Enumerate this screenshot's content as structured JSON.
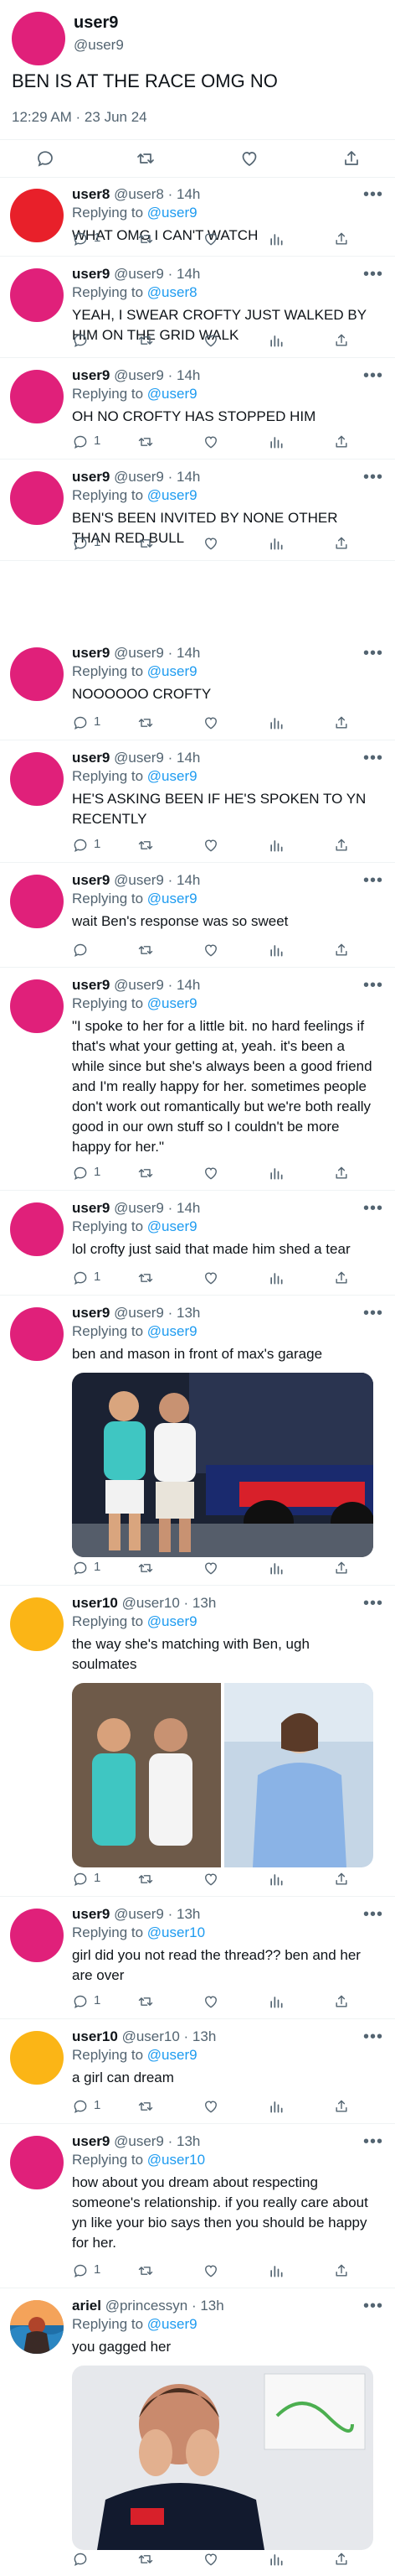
{
  "colors": {
    "magenta_avatar": "#e0207a",
    "red_avatar": "#e8202a",
    "yellow_avatar": "#fbb516",
    "mention_blue": "#1d9bf0",
    "secondary_text": "#536471"
  },
  "icons": [
    "reply-icon",
    "retweet-icon",
    "like-icon",
    "stats-icon",
    "share-icon",
    "more-icon"
  ],
  "main": {
    "name": "user9",
    "handle": "@user9",
    "text": "BEN IS AT THE RACE OMG NO",
    "time": "12:29 AM · 23 Jun 24"
  },
  "replies": [
    {
      "name": "user8",
      "handle": "@user8",
      "time": "· 14h",
      "replying_label": "Replying to",
      "replying_to": "@user9",
      "text": "WHAT OMG I CAN'T WATCH",
      "reply_count": "1"
    },
    {
      "name": "user9",
      "handle": "@user9",
      "time": "· 14h",
      "replying_label": "Replying to",
      "replying_to": "@user8",
      "text": "YEAH, I SWEAR CROFTY JUST WALKED BY HIM ON THE GRID WALK",
      "reply_count": ""
    },
    {
      "name": "user9",
      "handle": "@user9",
      "time": "· 14h",
      "replying_label": "Replying to",
      "replying_to": "@user9",
      "text": "OH NO CROFTY HAS STOPPED HIM",
      "reply_count": "1"
    },
    {
      "name": "user9",
      "handle": "@user9",
      "time": "· 14h",
      "replying_label": "Replying to",
      "replying_to": "@user9",
      "text": "BEN'S BEEN INVITED BY NONE OTHER THAN RED BULL",
      "reply_count": "1"
    },
    {
      "name": "user9",
      "handle": "@user9",
      "time": "· 14h",
      "replying_label": "Replying to",
      "replying_to": "@user9",
      "text": "NOOOOOO CROFTY",
      "reply_count": "1"
    },
    {
      "name": "user9",
      "handle": "@user9",
      "time": "· 14h",
      "replying_label": "Replying to",
      "replying_to": "@user9",
      "text": "HE'S ASKING BEEN IF HE'S SPOKEN TO YN RECENTLY",
      "reply_count": "1"
    },
    {
      "name": "user9",
      "handle": "@user9",
      "time": "· 14h",
      "replying_label": "Replying to",
      "replying_to": "@user9",
      "text": "wait Ben's response was so sweet",
      "reply_count": ""
    },
    {
      "name": "user9",
      "handle": "@user9",
      "time": "· 14h",
      "replying_label": "Replying to",
      "replying_to": "@user9",
      "text": "\"I spoke to her for a little bit. no hard feelings if that's what your getting at, yeah. it's been a while since but she's always been a good friend and I'm really happy for her. sometimes people don't work out romantically but we're both really good in our own stuff so I couldn't be more happy for her.\"",
      "reply_count": "1"
    },
    {
      "name": "user9",
      "handle": "@user9",
      "time": "· 14h",
      "replying_label": "Replying to",
      "replying_to": "@user9",
      "text": "lol crofty just said that made him shed a tear",
      "reply_count": "1"
    },
    {
      "name": "user9",
      "handle": "@user9",
      "time": "· 13h",
      "replying_label": "Replying to",
      "replying_to": "@user9",
      "text": "ben and mason in front of max's garage",
      "reply_count": "1"
    },
    {
      "name": "user10",
      "handle": "@user10",
      "time": "· 13h",
      "replying_label": "Replying to",
      "replying_to": "@user9",
      "text": "the way she's matching with Ben, ugh soulmates",
      "reply_count": "1"
    },
    {
      "name": "user9",
      "handle": "@user9",
      "time": "· 13h",
      "replying_label": "Replying to",
      "replying_to": "@user10",
      "text": "girl did you not read the thread?? ben and her are over",
      "reply_count": "1"
    },
    {
      "name": "user10",
      "handle": "@user10",
      "time": "· 13h",
      "replying_label": "Replying to",
      "replying_to": "@user9",
      "text": "a girl can dream",
      "reply_count": "1"
    },
    {
      "name": "user9",
      "handle": "@user9",
      "time": "· 13h",
      "replying_label": "Replying to",
      "replying_to": "@user10",
      "text": "how about you dream about respecting someone's relationship. if you really care about yn like your bio says then you should be happy for her.",
      "reply_count": "1"
    },
    {
      "name": "ariel",
      "handle": "@princessyn",
      "time": "· 13h",
      "replying_label": "Replying to",
      "replying_to": "@user9",
      "text": "you gagged her",
      "reply_count": ""
    }
  ]
}
